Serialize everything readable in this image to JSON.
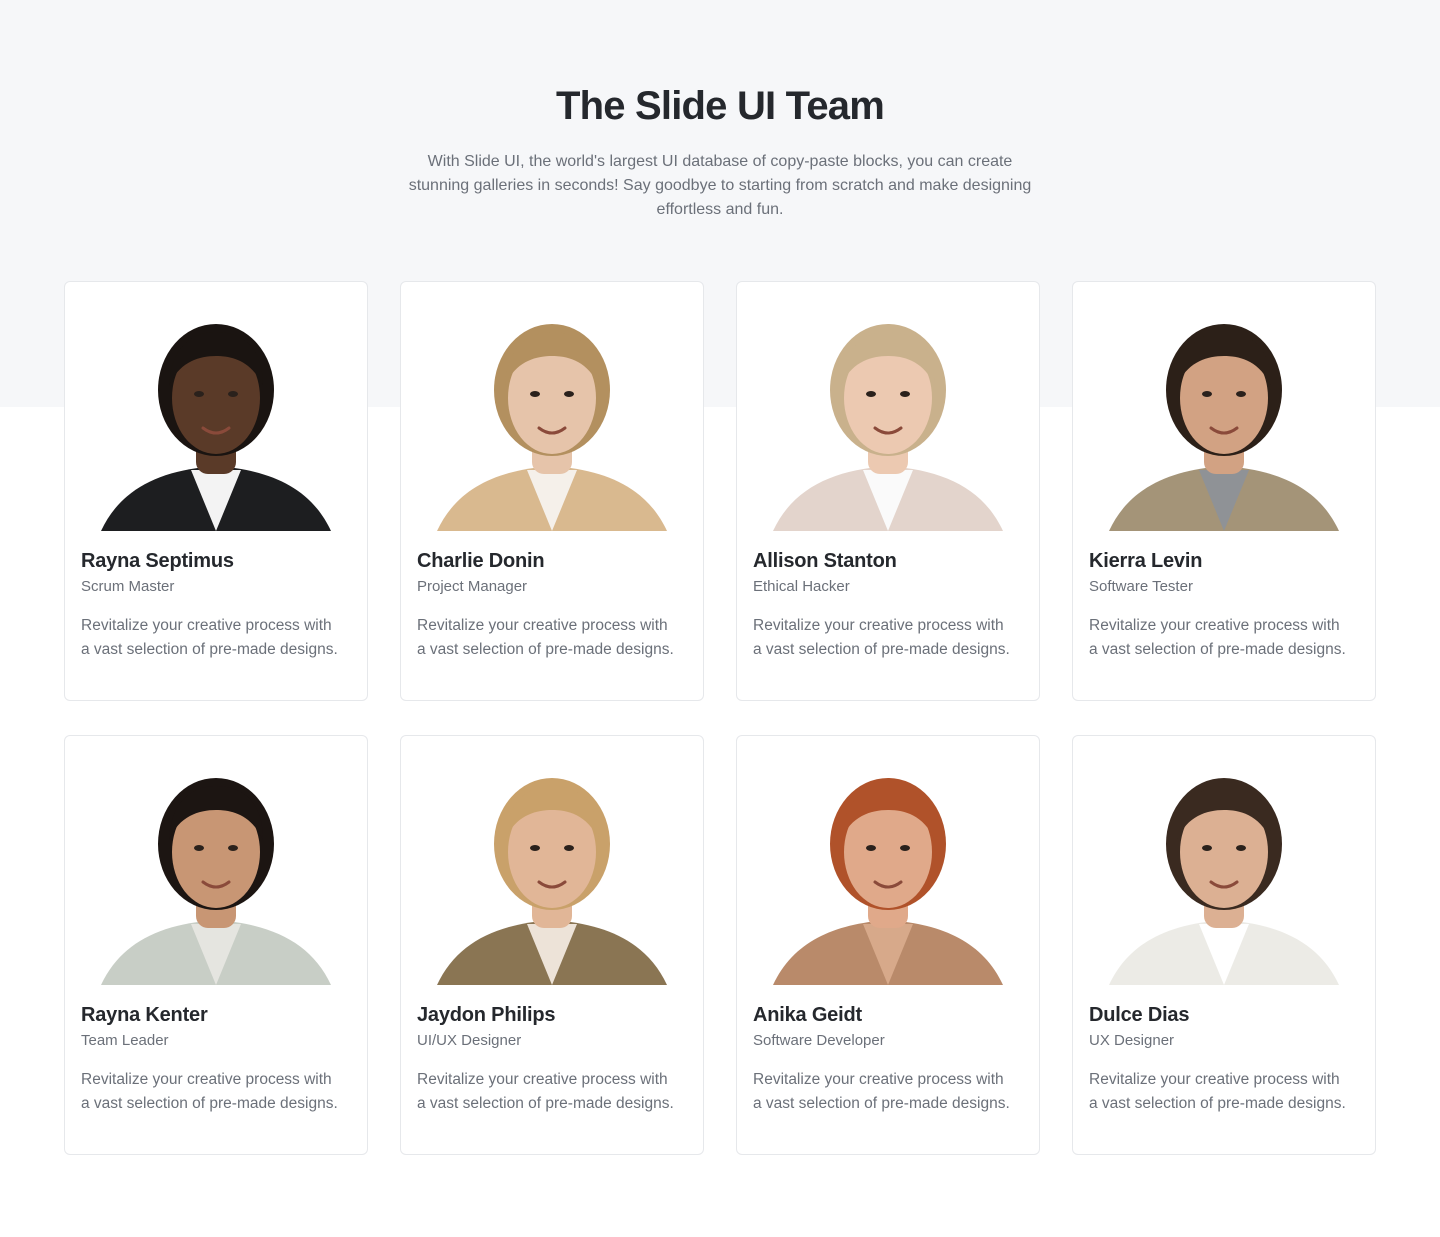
{
  "header": {
    "title": "The Slide UI Team",
    "subtitle": "With Slide UI, the world's largest UI database of copy-paste blocks, you can create stunning galleries in seconds! Say goodbye to starting from scratch and make designing effortless and fun."
  },
  "team": [
    {
      "name": "Rayna Septimus",
      "role": "Scrum Master",
      "description": "Revitalize your creative process with a vast selection of pre-made designs.",
      "skin": "#5a3a28",
      "hair": "#1a1411",
      "outfit": "#1d1e20",
      "shirt": "#f3f3f3"
    },
    {
      "name": "Charlie Donin",
      "role": "Project Manager",
      "description": "Revitalize your creative process with a vast selection of pre-made designs.",
      "skin": "#e6c4aa",
      "hair": "#b3905f",
      "outfit": "#d9b98f",
      "shirt": "#f5f0ea"
    },
    {
      "name": "Allison Stanton",
      "role": "Ethical Hacker",
      "description": "Revitalize your creative process with a vast selection of pre-made designs.",
      "skin": "#ecc9b1",
      "hair": "#c9b18c",
      "outfit": "#e3d4cc",
      "shirt": "#fafafa"
    },
    {
      "name": "Kierra Levin",
      "role": "Software Tester",
      "description": "Revitalize your creative process with a vast selection of pre-made designs.",
      "skin": "#d2a283",
      "hair": "#2c2018",
      "outfit": "#a49478",
      "shirt": "#8f9296"
    },
    {
      "name": "Rayna Kenter",
      "role": "Team Leader",
      "description": "Revitalize your creative process with a vast selection of pre-made designs.",
      "skin": "#c89674",
      "hair": "#1c1512",
      "outfit": "#c8cec6",
      "shirt": "#e5e5e0"
    },
    {
      "name": "Jaydon Philips",
      "role": "UI/UX Designer",
      "description": "Revitalize your creative process with a vast selection of pre-made designs.",
      "skin": "#e1b697",
      "hair": "#c9a16a",
      "outfit": "#8a7553",
      "shirt": "#ede3d8"
    },
    {
      "name": "Anika Geidt",
      "role": "Software Developer",
      "description": "Revitalize your creative process with a vast selection of pre-made designs.",
      "skin": "#e0a98a",
      "hair": "#b0522a",
      "outfit": "#b98a6a",
      "shirt": "#d7a98a"
    },
    {
      "name": "Dulce Dias",
      "role": "UX Designer",
      "description": "Revitalize your creative process with a vast selection of pre-made designs.",
      "skin": "#dcb093",
      "hair": "#3a2a20",
      "outfit": "#ecebe6",
      "shirt": "#ffffff"
    }
  ]
}
